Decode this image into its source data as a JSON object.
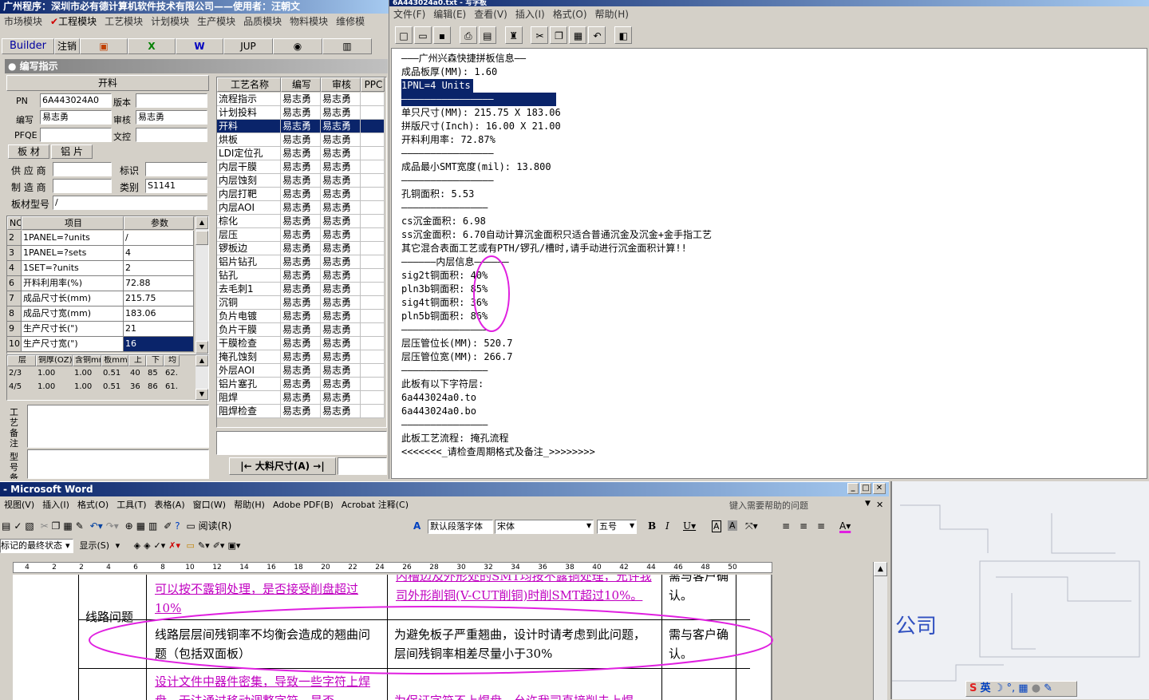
{
  "left_app": {
    "title": "广州程序：深圳市必有德计算机软件技术有限公司——使用者：汪朝文",
    "menu": [
      "市场模块",
      "工程模块",
      "工艺模块",
      "计划模块",
      "生产模块",
      "品质模块",
      "物料模块",
      "维修模"
    ],
    "toolbar": {
      "builder": "Builder",
      "logout": "注销",
      "jup": "JUP"
    },
    "section_title": "编写指示",
    "form": {
      "process_name": "开料",
      "pn_label": "PN",
      "pn_value": "6A443024A0",
      "version_label": "版本",
      "version_value": "",
      "author_label": "编写",
      "author_value": "易志勇",
      "reviewer_label": "审核",
      "reviewer_value": "易志勇",
      "pfqe_label": "PFQE",
      "pfqe_value": "",
      "doc_label": "文控",
      "doc_value": "",
      "tabs": [
        "板 材",
        "铝 片"
      ],
      "supplier_label": "供 应 商",
      "supplier_value": "",
      "mark_label": "标识",
      "mark_value": "",
      "maker_label": "制 造 商",
      "maker_value": "",
      "category_label": "类别",
      "category_value": "S1141",
      "model_label": "板材型号",
      "model_value": "/"
    },
    "param_table": {
      "headers": [
        "NO",
        "项目",
        "参数"
      ],
      "rows": [
        [
          "2",
          "1PANEL=?units",
          "/"
        ],
        [
          "3",
          "1PANEL=?sets",
          "4"
        ],
        [
          "4",
          "1SET=?units",
          "2"
        ],
        [
          "6",
          "开料利用率(%)",
          "72.88"
        ],
        [
          "7",
          "成品尺寸长(mm)",
          "215.75"
        ],
        [
          "8",
          "成品尺寸宽(mm)",
          "183.06"
        ],
        [
          "9",
          "生产尺寸长(\")",
          "21"
        ],
        [
          "10",
          "生产尺寸宽(\")",
          "16"
        ]
      ]
    },
    "layer_table": {
      "headers": [
        "层",
        "铜厚(OZ)",
        "含铜mm",
        "板mm",
        "上",
        "下",
        "均"
      ],
      "rows": [
        [
          "2/3",
          "1.00",
          "1.00",
          "0.51",
          "40",
          "85",
          "62."
        ],
        [
          "4/5",
          "1.00",
          "1.00",
          "0.51",
          "36",
          "86",
          "61."
        ]
      ]
    },
    "remark_label": "工艺备注",
    "model_remark_label": "型号备注",
    "process_table": {
      "headers": [
        "工艺名称",
        "编写",
        "审核",
        "PPC"
      ],
      "rows": [
        [
          "流程指示",
          "易志勇",
          "易志勇"
        ],
        [
          "计划投料",
          "易志勇",
          "易志勇"
        ],
        [
          "开料",
          "易志勇",
          "易志勇"
        ],
        [
          "烘板",
          "易志勇",
          "易志勇"
        ],
        [
          "LDI定位孔",
          "易志勇",
          "易志勇"
        ],
        [
          "内层干膜",
          "易志勇",
          "易志勇"
        ],
        [
          "内层蚀刻",
          "易志勇",
          "易志勇"
        ],
        [
          "内层打靶",
          "易志勇",
          "易志勇"
        ],
        [
          "内层AOI",
          "易志勇",
          "易志勇"
        ],
        [
          "棕化",
          "易志勇",
          "易志勇"
        ],
        [
          "层压",
          "易志勇",
          "易志勇"
        ],
        [
          "锣板边",
          "易志勇",
          "易志勇"
        ],
        [
          "铝片钻孔",
          "易志勇",
          "易志勇"
        ],
        [
          "钻孔",
          "易志勇",
          "易志勇"
        ],
        [
          "去毛刺1",
          "易志勇",
          "易志勇"
        ],
        [
          "沉铜",
          "易志勇",
          "易志勇"
        ],
        [
          "负片电镀",
          "易志勇",
          "易志勇"
        ],
        [
          "负片干膜",
          "易志勇",
          "易志勇"
        ],
        [
          "干膜检查",
          "易志勇",
          "易志勇"
        ],
        [
          "掩孔蚀刻",
          "易志勇",
          "易志勇"
        ],
        [
          "外层AOI",
          "易志勇",
          "易志勇"
        ],
        [
          "铝片塞孔",
          "易志勇",
          "易志勇"
        ],
        [
          "阻焊",
          "易志勇",
          "易志勇"
        ],
        [
          "阻焊检查",
          "易志勇",
          "易志勇"
        ]
      ],
      "selected_index": 2
    },
    "size_label": "大料尺寸(A)"
  },
  "notepad": {
    "title": "6A443024a0.txt - 写字板",
    "menu": [
      "文件(F)",
      "编辑(E)",
      "查看(V)",
      "插入(I)",
      "格式(O)",
      "帮助(H)"
    ],
    "lines": [
      "———广州兴森快捷拼板信息——",
      "成品板厚(MM): 1.60",
      "1PNL=4 Units",
      "————————————————",
      "单只尺寸(MM): 215.75 X 183.06",
      "拼版尺寸(Inch): 16.00 X 21.00",
      "开料利用率: 72.87%",
      "————————————————",
      "成品最小SMT宽度(mil): 13.800",
      "————————————————",
      "孔铜面积: 5.53",
      "———————————————",
      "cs沉金面积: 6.98",
      "ss沉金面积: 6.70自动计算沉金面积只适合普通沉金及沉金+金手指工艺",
      "其它混合表面工艺或有PTH/锣孔/槽时,请手动进行沉金面积计算!!",
      "——————内层信息——————",
      "sig2t铜面积: 40%",
      "pln3b铜面积: 85%",
      "sig4t铜面积: 36%",
      "pln5b铜面积: 86%",
      "———————————————",
      "层压管位长(MM): 520.7",
      "层压管位宽(MM): 266.7",
      "———————————————",
      "此板有以下字符层:",
      "6a443024a0.to",
      "6a443024a0.bo",
      "———————————————",
      "此板工艺流程: 掩孔流程",
      "<<<<<<<_请检查周期格式及备注_>>>>>>>>"
    ],
    "selected_lines": [
      2,
      3
    ]
  },
  "word": {
    "title": "- Microsoft Word",
    "menu": [
      "视图(V)",
      "插入(I)",
      "格式(O)",
      "工具(T)",
      "表格(A)",
      "窗口(W)",
      "帮助(H)",
      "Adobe PDF(B)",
      "Acrobat 注释(C)"
    ],
    "help_placeholder": "键入需要帮助的问题",
    "reading": "阅读(R)",
    "style": "默认段落字体",
    "font": "宋体",
    "size": "五号",
    "markup_state": "标记的最终状态",
    "show": "显示(S)",
    "ruler": [
      "4",
      "2",
      "2",
      "4",
      "6",
      "8",
      "10",
      "12",
      "14",
      "16",
      "18",
      "20",
      "22",
      "24",
      "26",
      "28",
      "30",
      "32",
      "34",
      "36",
      "38",
      "40",
      "42",
      "44",
      "46",
      "48",
      "50"
    ],
    "table": {
      "row1": {
        "category": "线路问题",
        "problem": "可以按不露铜处理，是否接受削盘超过10%",
        "solution": "内槽边及外形处的SMT均按不露铜处理，允许我司外形削铜(V-CUT削铜)时削SMT超过10%。",
        "confirm": "需与客户确认。"
      },
      "row2": {
        "problem": "线路层层间残铜率不均衡会造成的翘曲问题（包括双面板）",
        "solution": "为避免板子严重翘曲，设计时请考虑到此问题，层间残铜率相差尽量小于30%",
        "confirm": "需与客户确认。"
      },
      "row3": {
        "problem": "设计文件中器件密集，导致一些字符上焊盘，无法通过移动调整字符，是否",
        "solution": "为保证字符不上焊盘，允许我司直接削去上焊"
      }
    }
  },
  "ime": {
    "lang": "英"
  },
  "colors": {
    "titlebar": "#0a246a",
    "highlight": "#0a246a",
    "annotation": "#e020e0",
    "magenta_text": "#c000c0"
  }
}
